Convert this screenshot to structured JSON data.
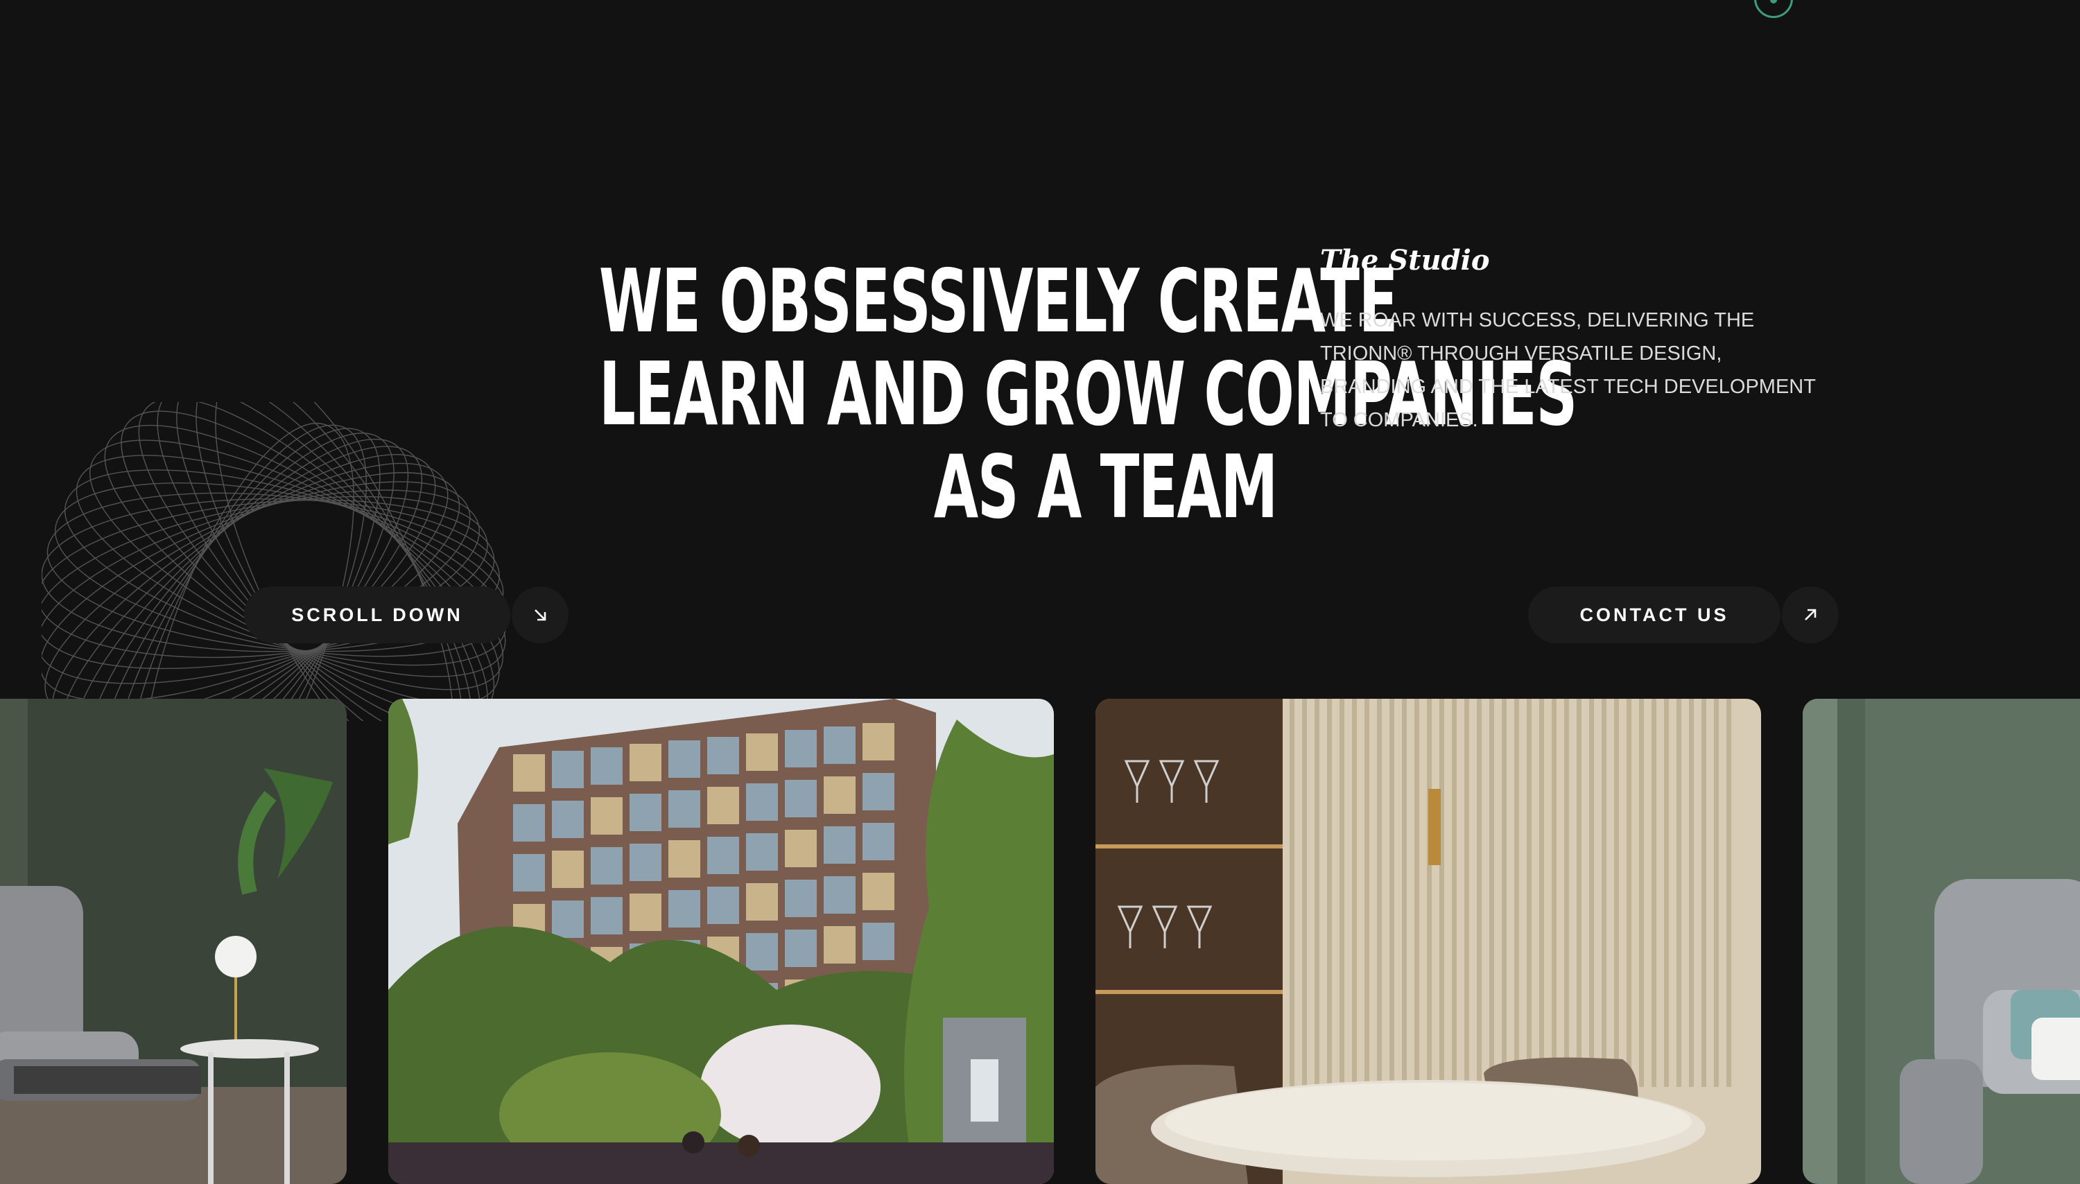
{
  "hero": {
    "headline_lines": [
      "WE OBSESSIVELY CREATE",
      "LEARN AND GROW COMPANIES",
      "AS A TEAM"
    ],
    "studio_title": "The Studio",
    "studio_description": "WE ROAR WITH SUCCESS, DELIVERING THE TRIONN® THROUGH VERSATILE DESIGN, BRANDING AND THE LATEST TECH DEVELOPMENT TO COMPANIES."
  },
  "actions": {
    "scroll_down_label": "SCROLL DOWN",
    "scroll_down_icon": "arrow-down-right-icon",
    "contact_label": "CONTACT US",
    "contact_icon": "arrow-up-right-icon"
  },
  "gallery": {
    "cards": [
      {
        "name": "living-room-chair"
      },
      {
        "name": "modern-building-exterior"
      },
      {
        "name": "dining-interior"
      },
      {
        "name": "lounge-chair-interior"
      }
    ]
  },
  "colors": {
    "background": "#121212",
    "button_bg": "#1b1b1b",
    "accent_green": "#3e9c7c"
  }
}
